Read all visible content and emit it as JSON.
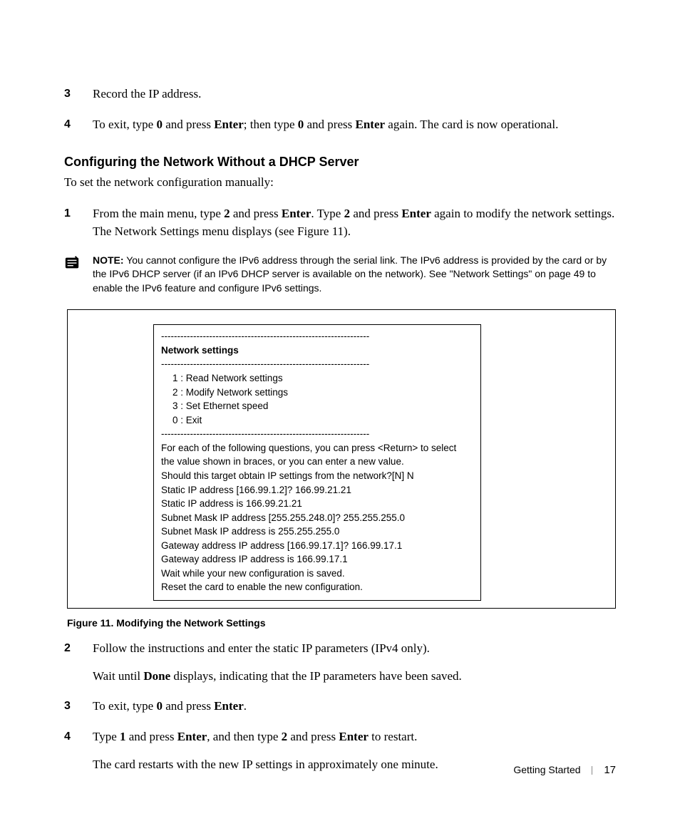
{
  "steps_top": [
    {
      "num": "3",
      "body_html": "Record the IP address."
    },
    {
      "num": "4",
      "body_html": "To exit, type <b>0</b> and press <b>Enter</b>; then type <b>0</b> and press <b>Enter</b> again. The card is now operational."
    }
  ],
  "heading": "Configuring the Network Without a DHCP Server",
  "intro": "To set the network configuration manually:",
  "step1": {
    "num": "1",
    "body_html": "From the main menu, type <b>2</b> and press <b>Enter</b>. Type <b>2</b> and press <b>Enter</b> again to modify the network settings. The Network Settings menu displays (see Figure 11)."
  },
  "note": {
    "label": "NOTE:",
    "text": " You cannot configure the IPv6 address through the serial link. The IPv6 address is provided by the card or by the IPv6 DHCP server (if an IPv6 DHCP server is available on the network). See \"Network Settings\" on page 49 to enable the IPv6 feature and configure IPv6 settings."
  },
  "figure": {
    "dashes": "-----------------------------------------------------------------",
    "title": "Network settings",
    "menu": [
      "1 : Read Network settings",
      "2 : Modify Network settings",
      "3 : Set Ethernet speed",
      "0 : Exit"
    ],
    "lines": [
      "For each of the following questions, you can press <Return> to select",
      "the value shown in braces, or you can enter a new value.",
      "Should this target obtain IP settings from the network?[N] N",
      "Static IP address [166.99.1.2]? 166.99.21.21",
      "Static IP address is 166.99.21.21",
      "Subnet Mask IP address [255.255.248.0]? 255.255.255.0",
      "Subnet Mask IP address is 255.255.255.0",
      "Gateway address IP address [166.99.17.1]? 166.99.17.1",
      "Gateway address IP address is 166.99.17.1",
      "Wait while your new configuration is saved.",
      "Reset the card to enable the new configuration."
    ],
    "caption": "Figure 11. Modifying the Network Settings"
  },
  "steps_bottom": [
    {
      "num": "2",
      "paras": [
        "Follow the instructions and enter the static IP parameters (IPv4 only).",
        "Wait until <b>Done</b> displays, indicating that the IP parameters have been saved."
      ]
    },
    {
      "num": "3",
      "paras": [
        "To exit, type <b>0</b> and press <b>Enter</b>."
      ]
    },
    {
      "num": "4",
      "paras": [
        "Type <b>1</b> and press <b>Enter</b>, and then type <b>2</b> and press <b>Enter</b> to restart.",
        "The card restarts with the new IP settings in approximately one minute."
      ]
    }
  ],
  "footer": {
    "section": "Getting Started",
    "page": "17"
  }
}
